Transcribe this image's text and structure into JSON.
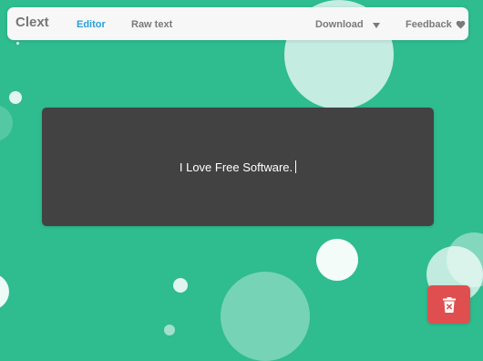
{
  "colors": {
    "background": "#2fbc8f",
    "navbar_bg": "#f7f7f7",
    "nav_active": "#2a9fd6",
    "nav_text": "#7a7a7a",
    "editor_bg": "#424242",
    "trash_bg": "#e04f4f"
  },
  "navbar": {
    "brand": "Clext",
    "tabs": [
      {
        "label": "Editor",
        "active": true
      },
      {
        "label": "Raw text",
        "active": false
      }
    ],
    "download_label": "Download",
    "download_icon": "caret-down-icon",
    "feedback_label": "Feedback",
    "feedback_icon": "heart-icon"
  },
  "editor": {
    "text": "I Love Free Software."
  },
  "actions": {
    "trash_icon": "trash-icon"
  }
}
